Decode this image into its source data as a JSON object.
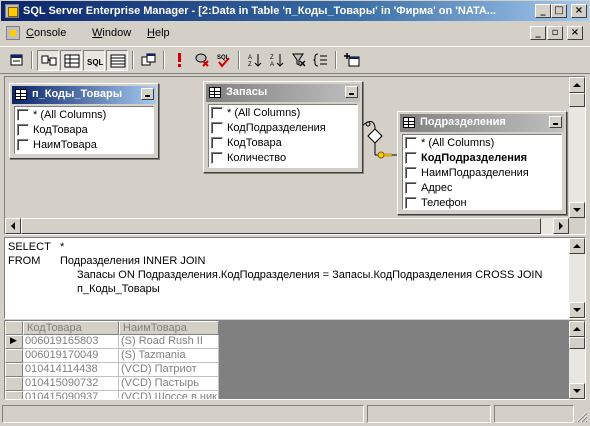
{
  "window": {
    "title": "SQL Server Enterprise Manager - [2:Data in Table 'п_Коды_Товары' in 'Фирма' on 'NATA...",
    "minimize": "_",
    "maximize": "□",
    "close": "×"
  },
  "menu": {
    "items": [
      "Console",
      "Window",
      "Help"
    ],
    "mdi_minimize": "_",
    "mdi_restore": "▫",
    "mdi_close": "×"
  },
  "toolbar": {
    "icons": [
      "properties-icon",
      "diagram-pane-icon",
      "grid-pane-icon",
      "sql-pane-icon",
      "results-pane-icon",
      "change-type-icon",
      "run-icon",
      "cancel-query-icon",
      "verify-sql-icon",
      "sort-ascending-icon",
      "sort-descending-icon",
      "remove-filter-icon",
      "group-by-icon",
      "add-table-icon"
    ],
    "sql_label": "SQL"
  },
  "diagram": {
    "tables": [
      {
        "name": "п_Коды_Товары",
        "active": true,
        "columns": [
          {
            "label": "* (All Columns)",
            "bold": false
          },
          {
            "label": "КодТовара",
            "bold": false
          },
          {
            "label": "НаимТовара",
            "bold": false
          }
        ]
      },
      {
        "name": "Запасы",
        "active": false,
        "columns": [
          {
            "label": "* (All Columns)",
            "bold": false
          },
          {
            "label": "КодПодразделения",
            "bold": false
          },
          {
            "label": "КодТовара",
            "bold": false
          },
          {
            "label": "Количество",
            "bold": false
          }
        ]
      },
      {
        "name": "Подразделения",
        "active": false,
        "columns": [
          {
            "label": "* (All Columns)",
            "bold": false
          },
          {
            "label": "КодПодразделения",
            "bold": true
          },
          {
            "label": "НаимПодразделения",
            "bold": false
          },
          {
            "label": "Адрес",
            "bold": false
          },
          {
            "label": "Телефон",
            "bold": false
          }
        ]
      }
    ]
  },
  "sql": {
    "lines": [
      {
        "kw": "SELECT",
        "text": "*"
      },
      {
        "kw": "FROM",
        "text": "Подразделения INNER JOIN"
      },
      {
        "kw": "",
        "text": "Запасы ON Подразделения.КодПодразделения = Запасы.КодПодразделения CROSS JOIN"
      },
      {
        "kw": "",
        "text": "п_Коды_Товары"
      }
    ]
  },
  "grid": {
    "columns": [
      "КодТовара",
      "НаимТовара"
    ],
    "rows": [
      [
        "006019165803",
        "(S) Road Rush II"
      ],
      [
        "006019170049",
        "(S) Tazmania"
      ],
      [
        "010414114438",
        "(VCD) Патриот"
      ],
      [
        "010415090732",
        "(VCD) Пастырь"
      ],
      [
        "010415090937",
        "(VCD) Шоссе в ник"
      ]
    ],
    "current_row_marker": "▶"
  },
  "colors": {
    "title_active": "#0a246a",
    "title_gradient_end": "#a6caf0",
    "face": "#d4d0c8",
    "shadow": "#808080"
  }
}
